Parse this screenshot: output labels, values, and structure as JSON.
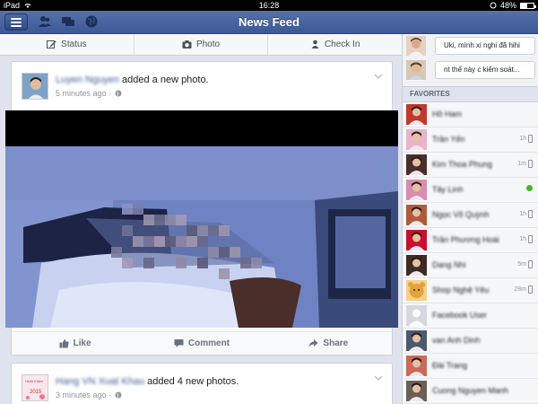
{
  "status_bar": {
    "device": "iPad",
    "time": "16:28",
    "battery": "48%",
    "battery_level": 0.48
  },
  "navbar": {
    "title": "News Feed",
    "icons": [
      "menu-icon",
      "friend-requests-icon",
      "messages-icon",
      "notifications-globe-icon"
    ]
  },
  "composer": {
    "status_label": "Status",
    "photo_label": "Photo",
    "checkin_label": "Check In"
  },
  "posts": [
    {
      "author": "Luyen Nguyen",
      "action": "added a new photo.",
      "time": "5 minutes ago",
      "actions": {
        "like": "Like",
        "comment": "Comment",
        "share": "Share"
      }
    },
    {
      "author": "Hang VN Xuat Khau",
      "action": "added 4 new photos.",
      "time": "3 minutes ago",
      "avatar_text": "Hello Kiiten",
      "avatar_year": "2015"
    }
  ],
  "sidebar": {
    "chats": [
      {
        "message": "Uki, mình xi nghi đã hihi"
      },
      {
        "message": "nt thế này c kiếm soát..."
      }
    ],
    "favorites_label": "FAVORITES",
    "friends": [
      {
        "name": "Hồ Ham",
        "status": "",
        "avatar_color": "#c0392b"
      },
      {
        "name": "Trần Yến",
        "status": "1h",
        "mobile": true,
        "avatar_color": "#e8b4c8"
      },
      {
        "name": "Kim Thoa Phung",
        "status": "1m",
        "mobile": true,
        "avatar_color": "#4a2e2a"
      },
      {
        "name": "Tây Linh",
        "status": "",
        "online": true,
        "avatar_color": "#d98cb0"
      },
      {
        "name": "Ngọc Võ Quỳnh",
        "status": "1h",
        "mobile": true,
        "avatar_color": "#b05a3c"
      },
      {
        "name": "Trần Phương Hoài",
        "status": "1h",
        "mobile": true,
        "avatar_color": "#c8102e"
      },
      {
        "name": "Dang Nhi",
        "status": "5m",
        "mobile": true,
        "avatar_color": "#3d2b26"
      },
      {
        "name": "Shop Nghệ Yêu",
        "status": "28m",
        "mobile": true,
        "avatar_color": "#e3a33a"
      },
      {
        "name": "Facebook User",
        "status": "",
        "avatar_color": "#d5d8de"
      },
      {
        "name": "van Anh Dinh",
        "status": "",
        "avatar_color": "#4a5a6e"
      },
      {
        "name": "Đài Trang",
        "status": "",
        "avatar_color": "#c96a5a"
      },
      {
        "name": "Cuong Nguyen Manh",
        "status": "",
        "avatar_color": "#6a6058"
      }
    ]
  },
  "colors": {
    "navbar": "#3b5998",
    "link": "#3b5998",
    "online": "#42b72a",
    "background": "#dfe3ee"
  }
}
